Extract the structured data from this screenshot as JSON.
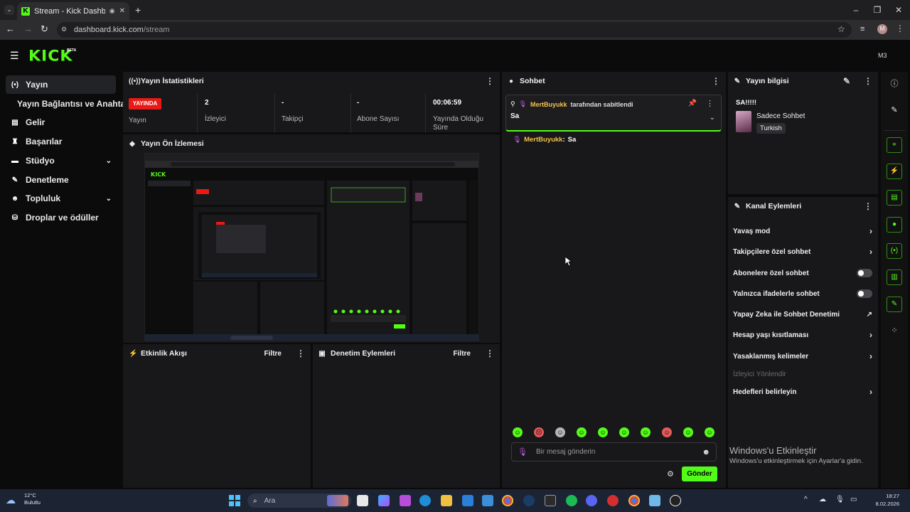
{
  "browser": {
    "tab_title": "Stream - Kick Dashboard",
    "url_host": "dashboard.kick.com",
    "url_path": "/stream",
    "profile_initial": "M"
  },
  "app": {
    "logo": "KICK",
    "logo_badge": "BETA",
    "user_initials": "M3"
  },
  "sidebar": {
    "items": [
      {
        "label": "Yayın",
        "icon": "broadcast-icon"
      },
      {
        "label": "Yayın Bağlantısı ve Anahtarı",
        "icon": ""
      },
      {
        "label": "Gelir",
        "icon": "chart-icon"
      },
      {
        "label": "Başarılar",
        "icon": "trophy-icon"
      },
      {
        "label": "Stüdyo",
        "icon": "studio-icon"
      },
      {
        "label": "Denetleme",
        "icon": "wrench-icon"
      },
      {
        "label": "Topluluk",
        "icon": "community-icon"
      },
      {
        "label": "Droplar ve ödüller",
        "icon": "drops-icon"
      }
    ]
  },
  "stats_panel": {
    "title": "Yayın İstatistikleri",
    "live_badge": "YAYINDA",
    "live_label": "Yayın",
    "stats": [
      {
        "value": "2",
        "label": "İzleyici"
      },
      {
        "value": "-",
        "label": "Takipçi"
      },
      {
        "value": "-",
        "label": "Abone Sayısı"
      },
      {
        "value": "00:06:59",
        "label": "Yayında Olduğu Süre"
      }
    ]
  },
  "preview_panel": {
    "title": "Yayın Ön İzlemesi"
  },
  "activity_panel": {
    "title": "Etkinlik Akışı",
    "filter": "Filtre"
  },
  "moderation_panel": {
    "title": "Denetim Eylemleri",
    "filter": "Filtre"
  },
  "chat": {
    "title": "Sohbet",
    "pinned_user": "MertBuyukk",
    "pinned_suffix": "tarafından sabitlendi",
    "pinned_message": "Sa",
    "messages": [
      {
        "user": "MertBuyukk",
        "text": "Sa"
      }
    ],
    "input_placeholder": "Bir mesaj gönderin",
    "send_label": "Gönder"
  },
  "stream_info": {
    "title": "Yayın bilgisi",
    "stream_title": "SA!!!!!",
    "category": "Sadece Sohbet",
    "tag": "Turkish"
  },
  "channel_actions": {
    "title": "Kanal Eylemleri",
    "rows": [
      {
        "label": "Yavaş mod",
        "kind": "chevron"
      },
      {
        "label": "Takipçilere özel sohbet",
        "kind": "chevron"
      },
      {
        "label": "Abonelere özel sohbet",
        "kind": "toggle"
      },
      {
        "label": "Yalnızca ifadelerle sohbet",
        "kind": "toggle"
      },
      {
        "label": "Yapay Zeka ile Sohbet Denetimi",
        "kind": "external"
      },
      {
        "label": "Hesap yaşı kısıtlaması",
        "kind": "chevron"
      },
      {
        "label": "Yasaklanmış kelimeler",
        "kind": "chevron"
      },
      {
        "label": "İzleyici Yönlendir",
        "kind": "disabled"
      },
      {
        "label": "Hedefleri belirleyin",
        "kind": "chevron"
      }
    ]
  },
  "windows_watermark": {
    "line1": "Windows'u Etkinleştir",
    "line2": "Windows'u etkinleştirmek için Ayarlar'a gidin."
  },
  "taskbar": {
    "weather_temp": "12°C",
    "weather_text": "Bulutlu",
    "search_placeholder": "Ara",
    "time": "18:27",
    "date": "8.02.2026"
  },
  "colors": {
    "accent": "#53fc18",
    "live": "#e91916",
    "panel": "#18181a",
    "background": "#0b0b0c"
  }
}
